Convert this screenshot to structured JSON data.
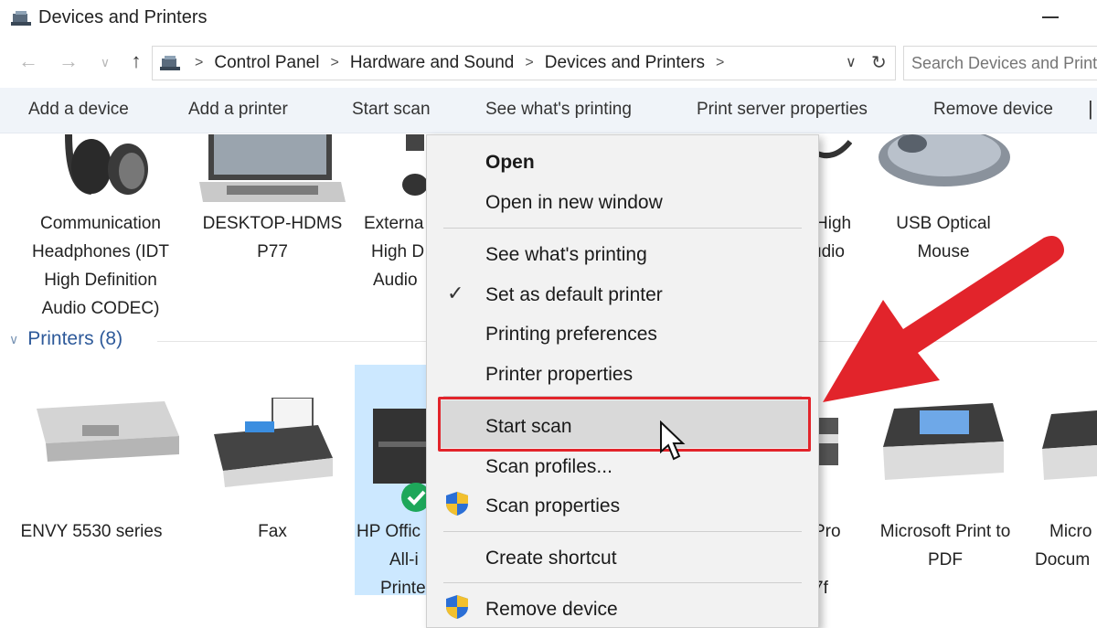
{
  "window": {
    "title": "Devices and Printers"
  },
  "address": {
    "crumbs": [
      "Control Panel",
      "Hardware and Sound",
      "Devices and Printers"
    ],
    "search_placeholder": "Search Devices and Printers"
  },
  "toolbar": {
    "commands": [
      "Add a device",
      "Add a printer",
      "Start scan",
      "See what's printing",
      "Print server properties",
      "Remove device"
    ]
  },
  "devices": [
    {
      "lines": [
        "Communication",
        "Headphones (IDT",
        "High Definition",
        "Audio CODEC)"
      ]
    },
    {
      "lines": [
        "DESKTOP-HDMS",
        "P77"
      ]
    },
    {
      "lines": [
        "Externa",
        "High D",
        "Audio"
      ]
    },
    {
      "lines": [
        "High",
        "udio"
      ]
    },
    {
      "lines": [
        "USB Optical",
        "Mouse"
      ]
    }
  ],
  "printers_section": {
    "label": "Printers (8)"
  },
  "printers": [
    {
      "lines": [
        "ENVY 5530 series"
      ]
    },
    {
      "lines": [
        "Fax"
      ]
    },
    {
      "lines": [
        "HP Offic",
        "All-i",
        "Printe"
      ]
    },
    {
      "lines": [
        "Pro",
        "7f"
      ]
    },
    {
      "lines": [
        "Microsoft Print to",
        "PDF"
      ]
    },
    {
      "lines": [
        "Micro",
        "Docum"
      ]
    }
  ],
  "context_menu": {
    "open": "Open",
    "open_new_window": "Open in new window",
    "see_whats_printing": "See what's printing",
    "set_default": "Set as default printer",
    "printing_preferences": "Printing preferences",
    "printer_properties": "Printer properties",
    "start_scan": "Start scan",
    "scan_profiles": "Scan profiles...",
    "scan_properties": "Scan properties",
    "create_shortcut": "Create shortcut",
    "remove_device": "Remove device"
  },
  "colors": {
    "accent": "#2e5a9a",
    "highlight_box": "#e2242b",
    "selection": "#cce8ff",
    "menu_bg": "#f2f2f2"
  },
  "icons": [
    "control-panel-icon",
    "back-arrow-icon",
    "forward-arrow-icon",
    "up-arrow-icon",
    "refresh-icon",
    "checkmark-icon",
    "uac-shield-icon",
    "red-arrow-icon",
    "mouse-cursor-icon"
  ]
}
